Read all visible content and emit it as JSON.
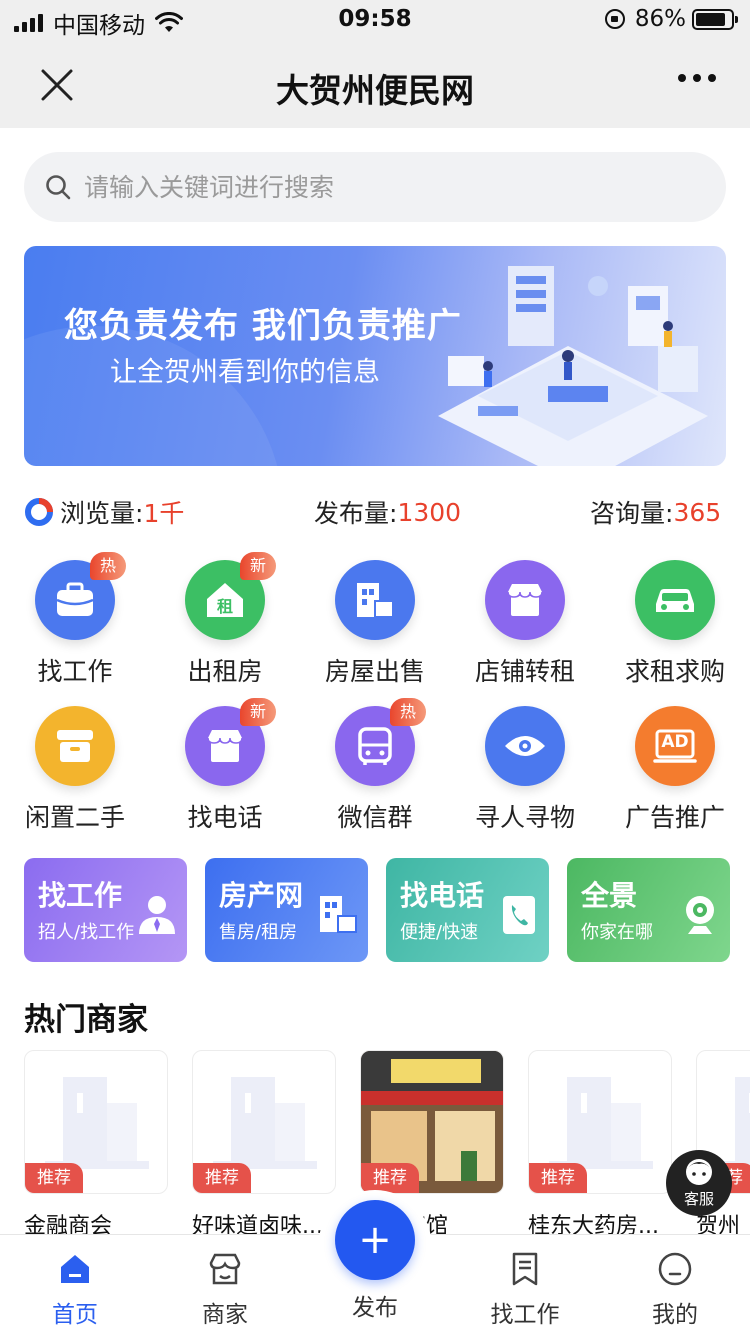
{
  "status_bar": {
    "carrier": "中国移动",
    "time": "09:58",
    "battery": "86%"
  },
  "nav": {
    "title": "大贺州便民网"
  },
  "search": {
    "placeholder": "请输入关键词进行搜索"
  },
  "banner": {
    "headline": "您负责发布 我们负责推广",
    "subline": "让全贺州看到你的信息"
  },
  "stats": {
    "views_label": "浏览量:",
    "views_value": "1千",
    "posts_label": "发布量:",
    "posts_value": "1300",
    "consult_label": "咨询量:",
    "consult_value": "365"
  },
  "grid": [
    {
      "label": "找工作",
      "icon": "briefcase-icon",
      "badge": "热",
      "color": "#4b78ee"
    },
    {
      "label": "出租房",
      "icon": "house-rent-icon",
      "badge": "新",
      "color": "#3cbf64"
    },
    {
      "label": "房屋出售",
      "icon": "building-icon",
      "badge": "",
      "color": "#4b78ee"
    },
    {
      "label": "店铺转租",
      "icon": "shop-icon",
      "badge": "",
      "color": "#8a67ee"
    },
    {
      "label": "求租求购",
      "icon": "car-icon",
      "badge": "",
      "color": "#3cbf64"
    },
    {
      "label": "闲置二手",
      "icon": "box-icon",
      "badge": "",
      "color": "#f3b42d"
    },
    {
      "label": "找电话",
      "icon": "shop-icon",
      "badge": "新",
      "color": "#8a67ee"
    },
    {
      "label": "微信群",
      "icon": "bus-icon",
      "badge": "热",
      "color": "#8a67ee"
    },
    {
      "label": "寻人寻物",
      "icon": "eye-icon",
      "badge": "",
      "color": "#4b78ee"
    },
    {
      "label": "广告推广",
      "icon": "ad-icon",
      "badge": "",
      "color": "#f47c2e",
      "ad_text": "AD"
    }
  ],
  "promos": [
    {
      "title": "找工作",
      "sub": "招人/找工作",
      "icon": "person-icon",
      "from": "#8b6cf0",
      "to": "#b496f5"
    },
    {
      "title": "房产网",
      "sub": "售房/租房",
      "icon": "building-icon",
      "from": "#3d6ff0",
      "to": "#6d97f6"
    },
    {
      "title": "找电话",
      "sub": "便捷/快速",
      "icon": "phone-book-icon",
      "from": "#3fb6a4",
      "to": "#6fd1c4"
    },
    {
      "title": "全景",
      "sub": "你家在哪",
      "icon": "camera-icon",
      "from": "#4cb862",
      "to": "#7fd68d"
    }
  ],
  "section": {
    "hot_merchants": "热门商家"
  },
  "merchants": [
    {
      "name": "金融商会",
      "tag": "推荐",
      "photo": false
    },
    {
      "name": "好味道卤味...",
      "tag": "推荐",
      "photo": false
    },
    {
      "name": "兄弟宾馆",
      "tag": "推荐",
      "photo": true
    },
    {
      "name": "桂东大药房...",
      "tag": "推荐",
      "photo": false
    },
    {
      "name": "贺州",
      "tag": "推荐",
      "photo": false
    }
  ],
  "customer_service": {
    "label": "客服"
  },
  "tabbar": {
    "home": "首页",
    "merchants": "商家",
    "publish": "发布",
    "jobs": "找工作",
    "mine": "我的",
    "publish_symbol": "+"
  }
}
